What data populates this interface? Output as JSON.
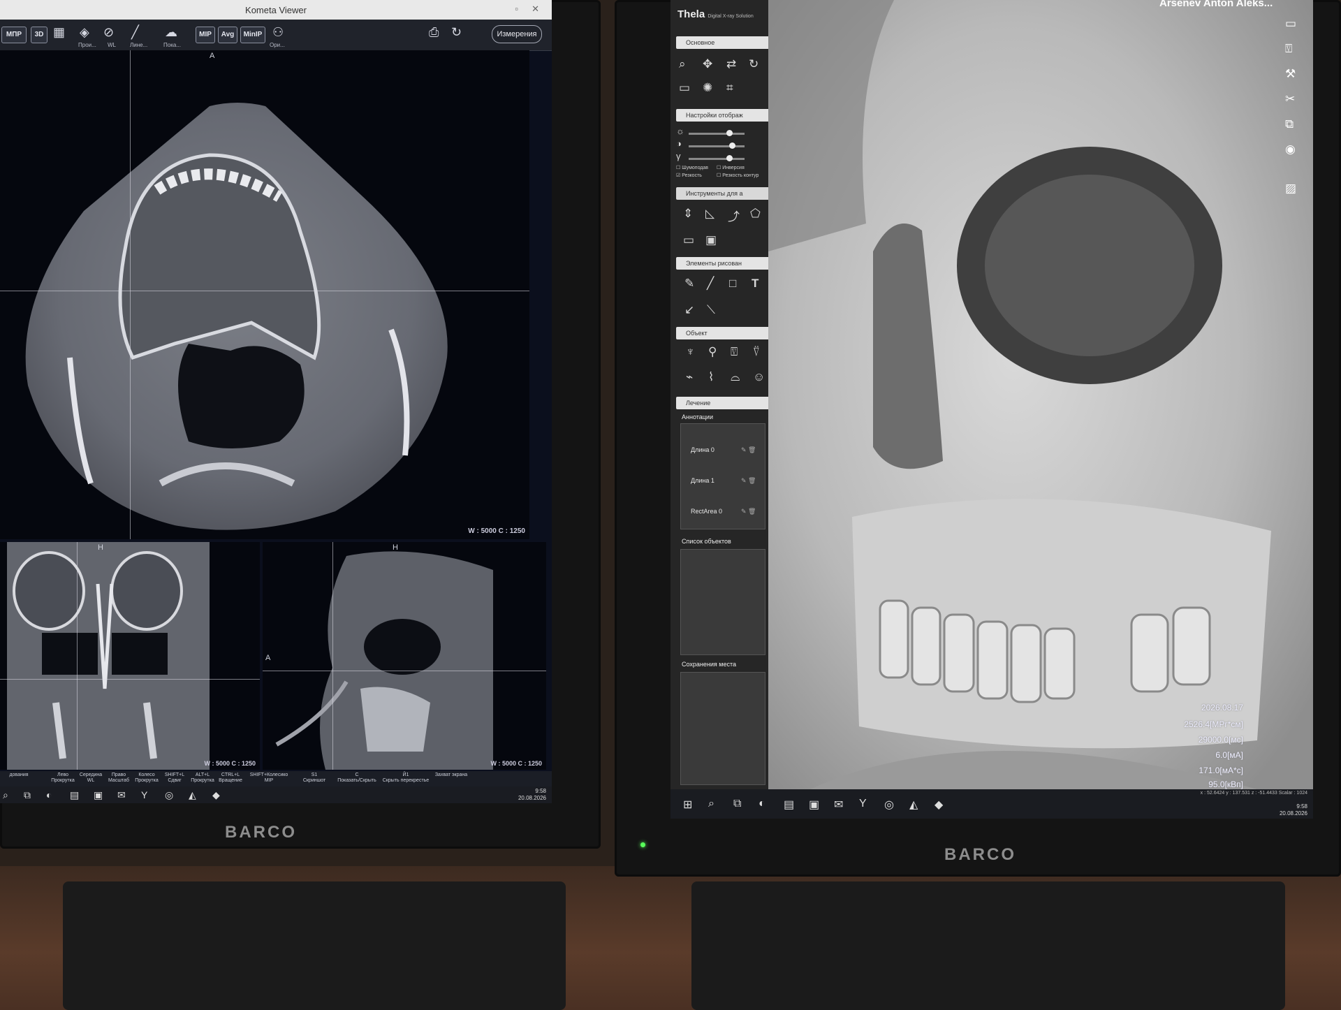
{
  "left": {
    "window_title": "Kometa Viewer",
    "toolbar": {
      "mpr": "МПР",
      "three_d": "3D",
      "labels": [
        "Прои...",
        "WL",
        "Лине...",
        "Пока..."
      ],
      "mip": "MIP",
      "avg": "Avg",
      "minip": "MinIP",
      "ori": "Ори...",
      "measure": "Измерения"
    },
    "viewports": {
      "axial_top": "A",
      "wl_axial": "W : 5000 C : 1250",
      "coronal_top": "H",
      "wl_coronal": "W : 5000 C : 1250",
      "sagittal_top": "H",
      "sagittal_left": "A",
      "wl_sagittal": "W : 5000 C : 1250"
    },
    "shortcuts": [
      {
        "key": "дования",
        "label": ""
      },
      {
        "key": "Лево",
        "label": "Прокрутка"
      },
      {
        "key": "Середина",
        "label": "WL"
      },
      {
        "key": "Право",
        "label": "Масштаб"
      },
      {
        "key": "Колесо",
        "label": "Прокрутка"
      },
      {
        "key": "SHIFT+L",
        "label": "Сдвиг"
      },
      {
        "key": "ALT+L",
        "label": "Прокрутка"
      },
      {
        "key": "CTRL+L",
        "label": "Вращение"
      },
      {
        "key": "SHIFT+Колесико",
        "label": "MIP"
      },
      {
        "key": "S1",
        "label": "Скриншот"
      },
      {
        "key": "C",
        "label": "Показать/Скрыть"
      },
      {
        "key": "Й1",
        "label": "Скрыть перекрестье"
      },
      {
        "key": "",
        "label": "Захват экрана"
      }
    ],
    "clock": {
      "time": "9:58",
      "date": "20.08.2026"
    }
  },
  "right": {
    "brand": "Thelа",
    "brand_sub": "Digital X-ray Solution",
    "user": "Arsenev Anton Aleks...",
    "sections": {
      "basic": "Основное",
      "display": "Настройки отображ",
      "tools": "Инструменты для а",
      "draw": "Элементы рисован",
      "object": "Объект",
      "treatment": "Лечение"
    },
    "checks": {
      "denoise": "Шумоподав",
      "invert": "Инверсия",
      "sharp": "Резкость",
      "sharp_contour": "Резкость контур"
    },
    "annotations": {
      "title": "Аннотации",
      "items": [
        "Длина 0",
        "Длина 1",
        "RectArea 0"
      ]
    },
    "objects_title": "Список объектов",
    "saved_title": "Сохранения места",
    "info": {
      "date": "2026.08.17",
      "l1": "2526.4[МРг*см]",
      "l2": "29000.0[мс]",
      "l3": "6.0[мА]",
      "l4": "171.0[мА*с]",
      "l5": "95.0[кВп]"
    },
    "status": "x : 52.6424  y : 137.531  z : -51.4433  Scalar : 1024",
    "clock": {
      "time": "9:58",
      "date": "20.08.2026"
    }
  },
  "bezel": {
    "left": "BARCO",
    "right": "BARCO"
  }
}
